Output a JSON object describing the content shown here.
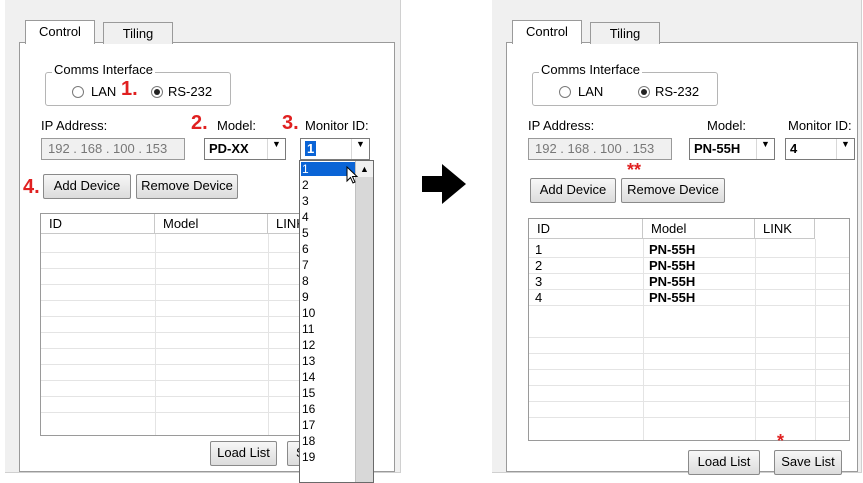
{
  "left": {
    "tabs": [
      "Control",
      "Tiling"
    ],
    "comms_title": "Comms Interface",
    "radio_lan": "LAN",
    "radio_rs232": "RS-232",
    "step1": "1.",
    "step2": "2.",
    "step3": "3.",
    "step4": "4.",
    "ip_label": "IP Address:",
    "ip_value": "192 . 168 . 100 . 153",
    "model_label": "Model:",
    "model_value": "PD-XX",
    "monitor_label": "Monitor ID:",
    "monitor_value": "1",
    "add_device": "Add Device",
    "remove_device": "Remove Device",
    "columns": [
      "ID",
      "Model",
      "LINK"
    ],
    "load_list": "Load List",
    "save_list_partial": "S",
    "dropdown_options": [
      "1",
      "2",
      "3",
      "4",
      "5",
      "6",
      "7",
      "8",
      "9",
      "10",
      "11",
      "12",
      "13",
      "14",
      "15",
      "16",
      "17",
      "18",
      "19"
    ]
  },
  "right": {
    "tabs": [
      "Control",
      "Tiling"
    ],
    "comms_title": "Comms Interface",
    "radio_lan": "LAN",
    "radio_rs232": "RS-232",
    "ip_label": "IP Address:",
    "ip_value": "192 . 168 . 100 . 153",
    "model_label": "Model:",
    "model_value": "PN-55H",
    "monitor_label": "Monitor ID:",
    "monitor_value": "4",
    "add_device": "Add Device",
    "remove_device": "Remove Device",
    "double_star": "**",
    "single_star": "*",
    "columns": [
      "ID",
      "Model",
      "LINK"
    ],
    "rows": [
      {
        "id": "1",
        "model": "PN-55H"
      },
      {
        "id": "2",
        "model": "PN-55H"
      },
      {
        "id": "3",
        "model": "PN-55H"
      },
      {
        "id": "4",
        "model": "PN-55H"
      }
    ],
    "load_list": "Load List",
    "save_list": "Save List"
  },
  "colors": {
    "accent_red": "#e02020",
    "selection_blue": "#0a64d6"
  }
}
